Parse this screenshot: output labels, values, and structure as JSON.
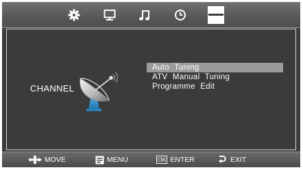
{
  "top_tabs": [
    {
      "icon": "gear-icon"
    },
    {
      "icon": "monitor-icon"
    },
    {
      "icon": "music-note-icon"
    },
    {
      "icon": "clock-icon"
    },
    {
      "icon": "channel-grid-icon"
    }
  ],
  "section": {
    "label": "CHANNEL",
    "icon": "satellite-dish-icon"
  },
  "menu": {
    "items": [
      {
        "label": "Auto  Tuning",
        "selected": true
      },
      {
        "label": "ATV  Manual  Tuning",
        "selected": false
      },
      {
        "label": "Programme  Edit",
        "selected": false
      }
    ]
  },
  "footer": {
    "move": {
      "icon": "dpad-icon",
      "label": "MOVE"
    },
    "menu": {
      "icon": "menu-icon",
      "label": "MENU"
    },
    "enter": {
      "key": "OK",
      "label": "ENTER"
    },
    "exit": {
      "icon": "return-icon",
      "label": "EXIT"
    }
  },
  "colors": {
    "background": "#3b3b3b",
    "selection": "#9b9b9b"
  }
}
